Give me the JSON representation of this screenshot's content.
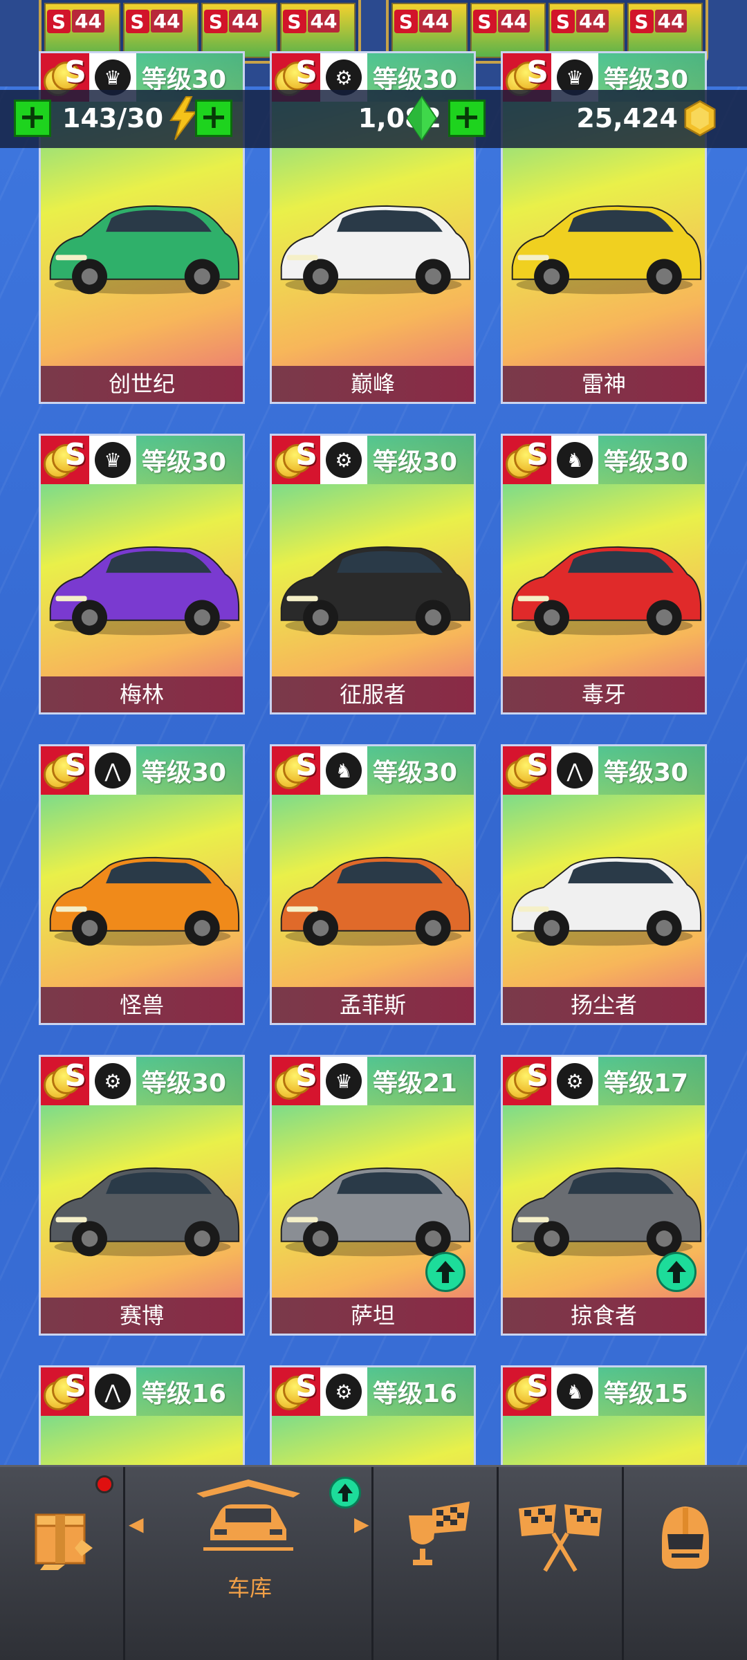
{
  "currency": {
    "energy": "143/30",
    "gems": "1,082",
    "coins": "25,424"
  },
  "top_rewards": {
    "cells": [
      {
        "badge": "S",
        "value": "44"
      },
      {
        "badge": "S",
        "value": "44"
      },
      {
        "badge": "S",
        "value": "44"
      },
      {
        "badge": "S",
        "value": "44"
      },
      {
        "badge": "S",
        "value": "44"
      },
      {
        "badge": "S",
        "value": "44"
      },
      {
        "badge": "S",
        "value": "44"
      },
      {
        "badge": "S",
        "value": "44"
      }
    ]
  },
  "cars": [
    {
      "name": "创世纪",
      "level": "等级30",
      "class_icon": "crown-icon",
      "color": "#2fb06a"
    },
    {
      "name": "巅峰",
      "level": "等级30",
      "class_icon": "wheel-icon",
      "color": "#f2f2f2"
    },
    {
      "name": "雷神",
      "level": "等级30",
      "class_icon": "crown-icon",
      "color": "#f0d020"
    },
    {
      "name": "梅林",
      "level": "等级30",
      "class_icon": "crown-icon",
      "color": "#7a3ad0"
    },
    {
      "name": "征服者",
      "level": "等级30",
      "class_icon": "wheel-icon",
      "color": "#2a2a2a"
    },
    {
      "name": "毒牙",
      "level": "等级30",
      "class_icon": "horse-icon",
      "color": "#e02a2a"
    },
    {
      "name": "怪兽",
      "level": "等级30",
      "class_icon": "road-icon",
      "color": "#f08a1a"
    },
    {
      "name": "孟菲斯",
      "level": "等级30",
      "class_icon": "horse-icon",
      "color": "#e06a2a"
    },
    {
      "name": "扬尘者",
      "level": "等级30",
      "class_icon": "road-icon",
      "color": "#f0f0f0"
    },
    {
      "name": "赛博",
      "level": "等级30",
      "class_icon": "wheel-icon",
      "color": "#555a60"
    },
    {
      "name": "萨坦",
      "level": "等级21",
      "class_icon": "crown-icon",
      "color": "#8a8e94",
      "upgrade": true
    },
    {
      "name": "掠食者",
      "level": "等级17",
      "class_icon": "wheel-icon",
      "color": "#6a6d72",
      "upgrade": true
    },
    {
      "name": "",
      "level": "等级16",
      "class_icon": "road-icon",
      "color": "#f0f0f0"
    },
    {
      "name": "",
      "level": "等级16",
      "class_icon": "wheel-icon",
      "color": "#f0f0f0"
    },
    {
      "name": "",
      "level": "等级15",
      "class_icon": "horse-icon",
      "color": "#f0f0f0"
    }
  ],
  "nav": {
    "garage_label": "车库"
  }
}
